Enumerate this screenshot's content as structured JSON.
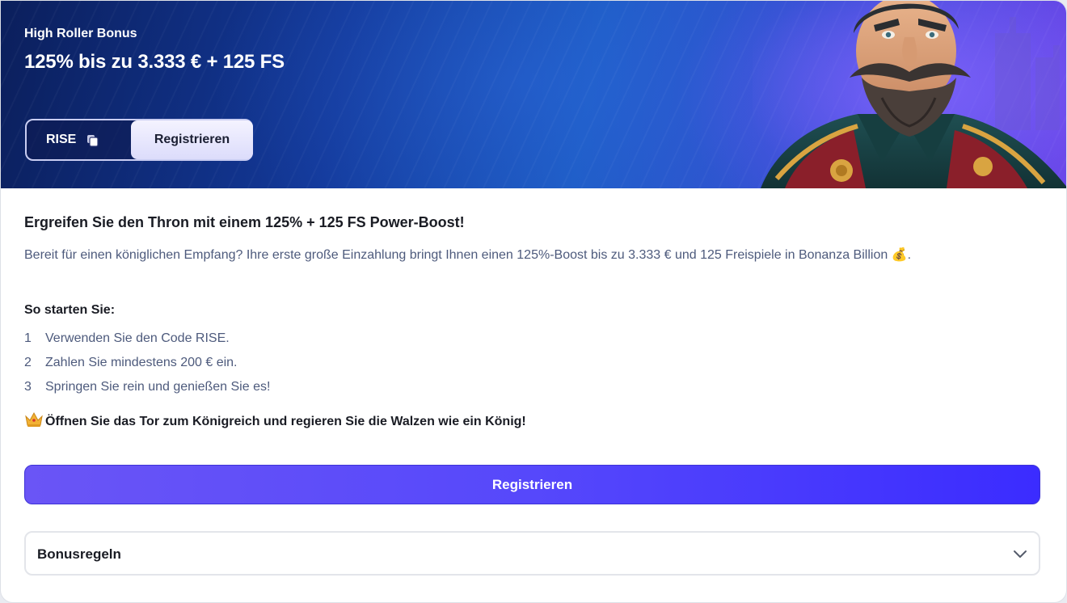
{
  "banner": {
    "subtitle": "High Roller Bonus",
    "title": "125% bis zu 3.333 € + 125 FS",
    "promo_code": "RISE",
    "copy_icon": "copy-icon",
    "register_label": "Registrieren",
    "artwork": "bearded-king-character-illustration"
  },
  "content": {
    "heading": "Ergreifen Sie den Thron mit einem 125% + 125 FS Power-Boost!",
    "description": "Bereit für einen königlichen Empfang? Ihre erste große Einzahlung bringt Ihnen einen 125%-Boost bis zu 3.333 € und 125 Freispiele in Bonanza Billion 💰.",
    "steps_heading": "So starten Sie:",
    "steps": [
      {
        "number": "1",
        "text": "Verwenden Sie den Code RISE."
      },
      {
        "number": "2",
        "text": "Zahlen Sie mindestens 200 € ein."
      },
      {
        "number": "3",
        "text": "Springen Sie rein und genießen Sie es!"
      }
    ],
    "closing_icon": "crown-icon",
    "closing": "Öffnen Sie das Tor zum Königreich und regieren Sie die Walzen wie ein König!"
  },
  "actions": {
    "register_label": "Registrieren"
  },
  "accordion": {
    "label": "Bonusregeln",
    "icon": "chevron-down-icon"
  },
  "colors": {
    "primary_button": "#5648fb",
    "banner_dark": "#0b1f5c",
    "banner_light": "#6b46e8",
    "text_dark": "#1a1c24",
    "text_muted": "#4d5a7c"
  }
}
